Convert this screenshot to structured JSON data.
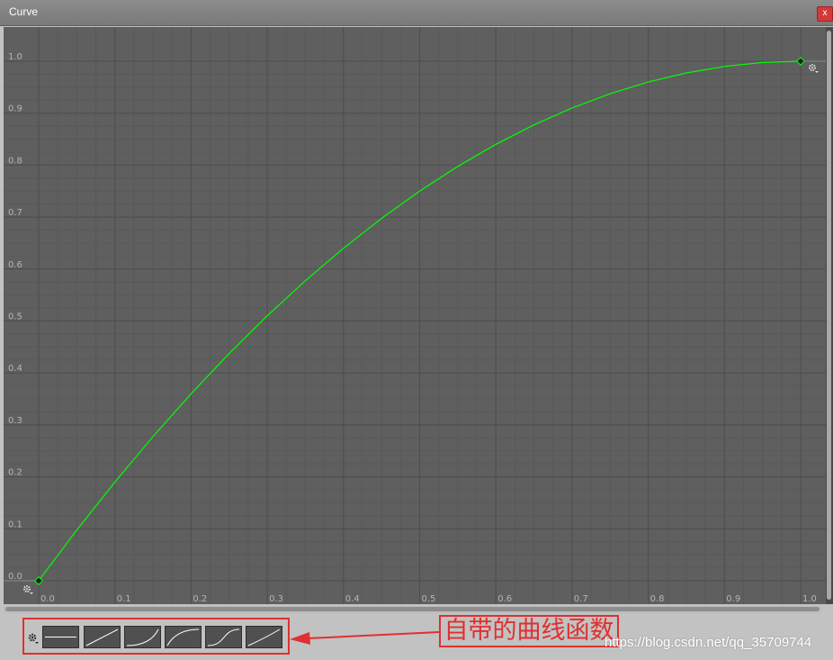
{
  "window": {
    "title": "Curve",
    "close_label": "x"
  },
  "chart_data": {
    "type": "line",
    "x_ticks": [
      "0.0",
      "0.1",
      "0.2",
      "0.3",
      "0.4",
      "0.5",
      "0.6",
      "0.7",
      "0.8",
      "0.9",
      "1.0"
    ],
    "y_ticks": [
      "0.0",
      "0.1",
      "0.2",
      "0.3",
      "0.4",
      "0.5",
      "0.6",
      "0.7",
      "0.8",
      "0.9",
      "1.0"
    ],
    "xlim": [
      0,
      1
    ],
    "ylim": [
      0,
      1
    ],
    "grid": true,
    "series": [
      {
        "color": "#00ff00",
        "x": [
          0,
          0.05,
          0.1,
          0.15,
          0.2,
          0.25,
          0.3,
          0.35,
          0.4,
          0.45,
          0.5,
          0.55,
          0.6,
          0.65,
          0.7,
          0.75,
          0.8,
          0.85,
          0.9,
          0.95,
          1.0
        ],
        "y": [
          0,
          0.0975,
          0.19,
          0.2775,
          0.36,
          0.4375,
          0.51,
          0.5775,
          0.64,
          0.6975,
          0.75,
          0.7975,
          0.84,
          0.8775,
          0.91,
          0.9375,
          0.96,
          0.9775,
          0.99,
          0.9975,
          1.0
        ]
      }
    ],
    "keyframes": [
      {
        "x": 0,
        "y": 0
      },
      {
        "x": 1,
        "y": 1
      }
    ]
  },
  "colors": {
    "background": "#5f5f5f",
    "grid_major": "#4e4e4e",
    "grid_minor": "#595959",
    "curve": "#00ff00",
    "tick_label": "#b5b5b5",
    "annotation": "#e03030"
  },
  "presets": {
    "gear_icon": "gear-icon",
    "items": [
      "flat",
      "linear",
      "ease-in",
      "ease-out",
      "ease-in-out",
      "linear-slight"
    ]
  },
  "annotation": {
    "text": "自带的曲线函数"
  },
  "watermark": {
    "text": "https://blog.csdn.net/qq_35709744"
  }
}
